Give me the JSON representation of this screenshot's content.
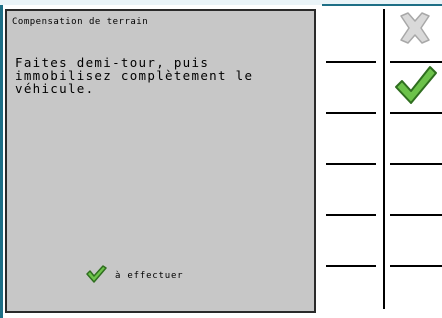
{
  "dialog": {
    "title": "Compensation de terrain",
    "message": "Faites demi-tour, puis\nimmobilisez complètement le\nvéhicule.",
    "hint_icon": "check-icon",
    "hint_label": "à effectuer"
  },
  "softkeys": {
    "cancel_icon": "close-icon",
    "confirm_icon": "check-icon"
  },
  "colors": {
    "accent": "#1e6f86",
    "dialog_background": "#c7c7c7",
    "check_fill": "#6cc24a",
    "check_stroke": "#2f6e1f",
    "disabled_icon": "#c8c8c8"
  }
}
